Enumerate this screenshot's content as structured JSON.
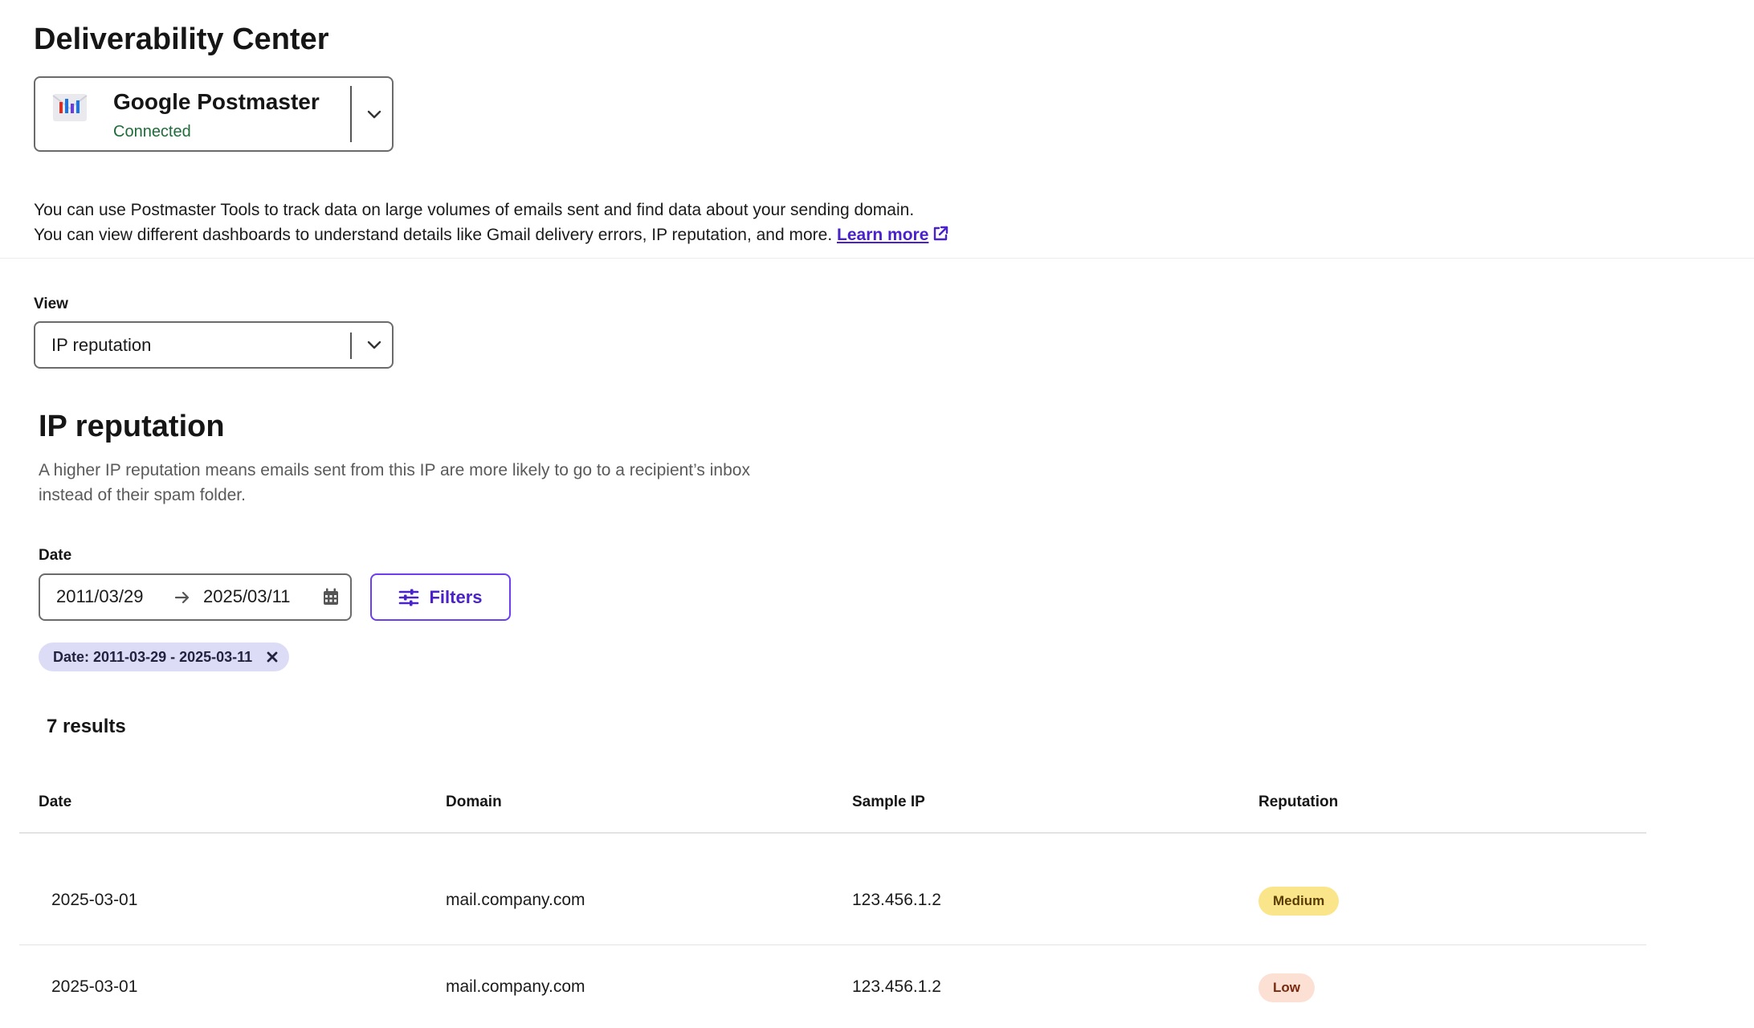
{
  "page_title": "Deliverability Center",
  "integration": {
    "name": "Google Postmaster",
    "status": "Connected",
    "logo_icon": "postmaster-logo-icon",
    "status_color": "#1f6b3a"
  },
  "intro": {
    "line1": "You can use Postmaster Tools to track data on large volumes of emails sent and find data about your sending domain.",
    "line2": "You can view different dashboards to understand details like Gmail delivery errors, IP reputation, and more.",
    "learn_more": "Learn more"
  },
  "view": {
    "label": "View",
    "selected": "IP reputation"
  },
  "section": {
    "title": "IP reputation",
    "description_line1": "A higher IP reputation means emails sent from this IP are more likely to go to a recipient’s inbox",
    "description_line2": "instead of their spam folder."
  },
  "date_filter": {
    "label": "Date",
    "start": "2011/03/29",
    "end": "2025/03/11"
  },
  "filters_button": "Filters",
  "active_filter_chip": "Date: 2011-03-29 - 2025-03-11",
  "results_count": "7 results",
  "table": {
    "headers": [
      "Date",
      "Domain",
      "Sample IP",
      "Reputation"
    ],
    "rows": [
      {
        "date": "2025-03-01",
        "domain": "mail.company.com",
        "sample_ip": "123.456.1.2",
        "reputation": "Medium"
      },
      {
        "date": "2025-03-01",
        "domain": "mail.company.com",
        "sample_ip": "123.456.1.2",
        "reputation": "Low"
      }
    ]
  },
  "colors": {
    "accent": "#4a22c9",
    "badge_medium_bg": "#fbe58a",
    "badge_medium_text": "#5a3b00",
    "badge_low_bg": "#fde0d4",
    "badge_low_text": "#7a2a10",
    "chip_bg": "#dcdcf7"
  }
}
